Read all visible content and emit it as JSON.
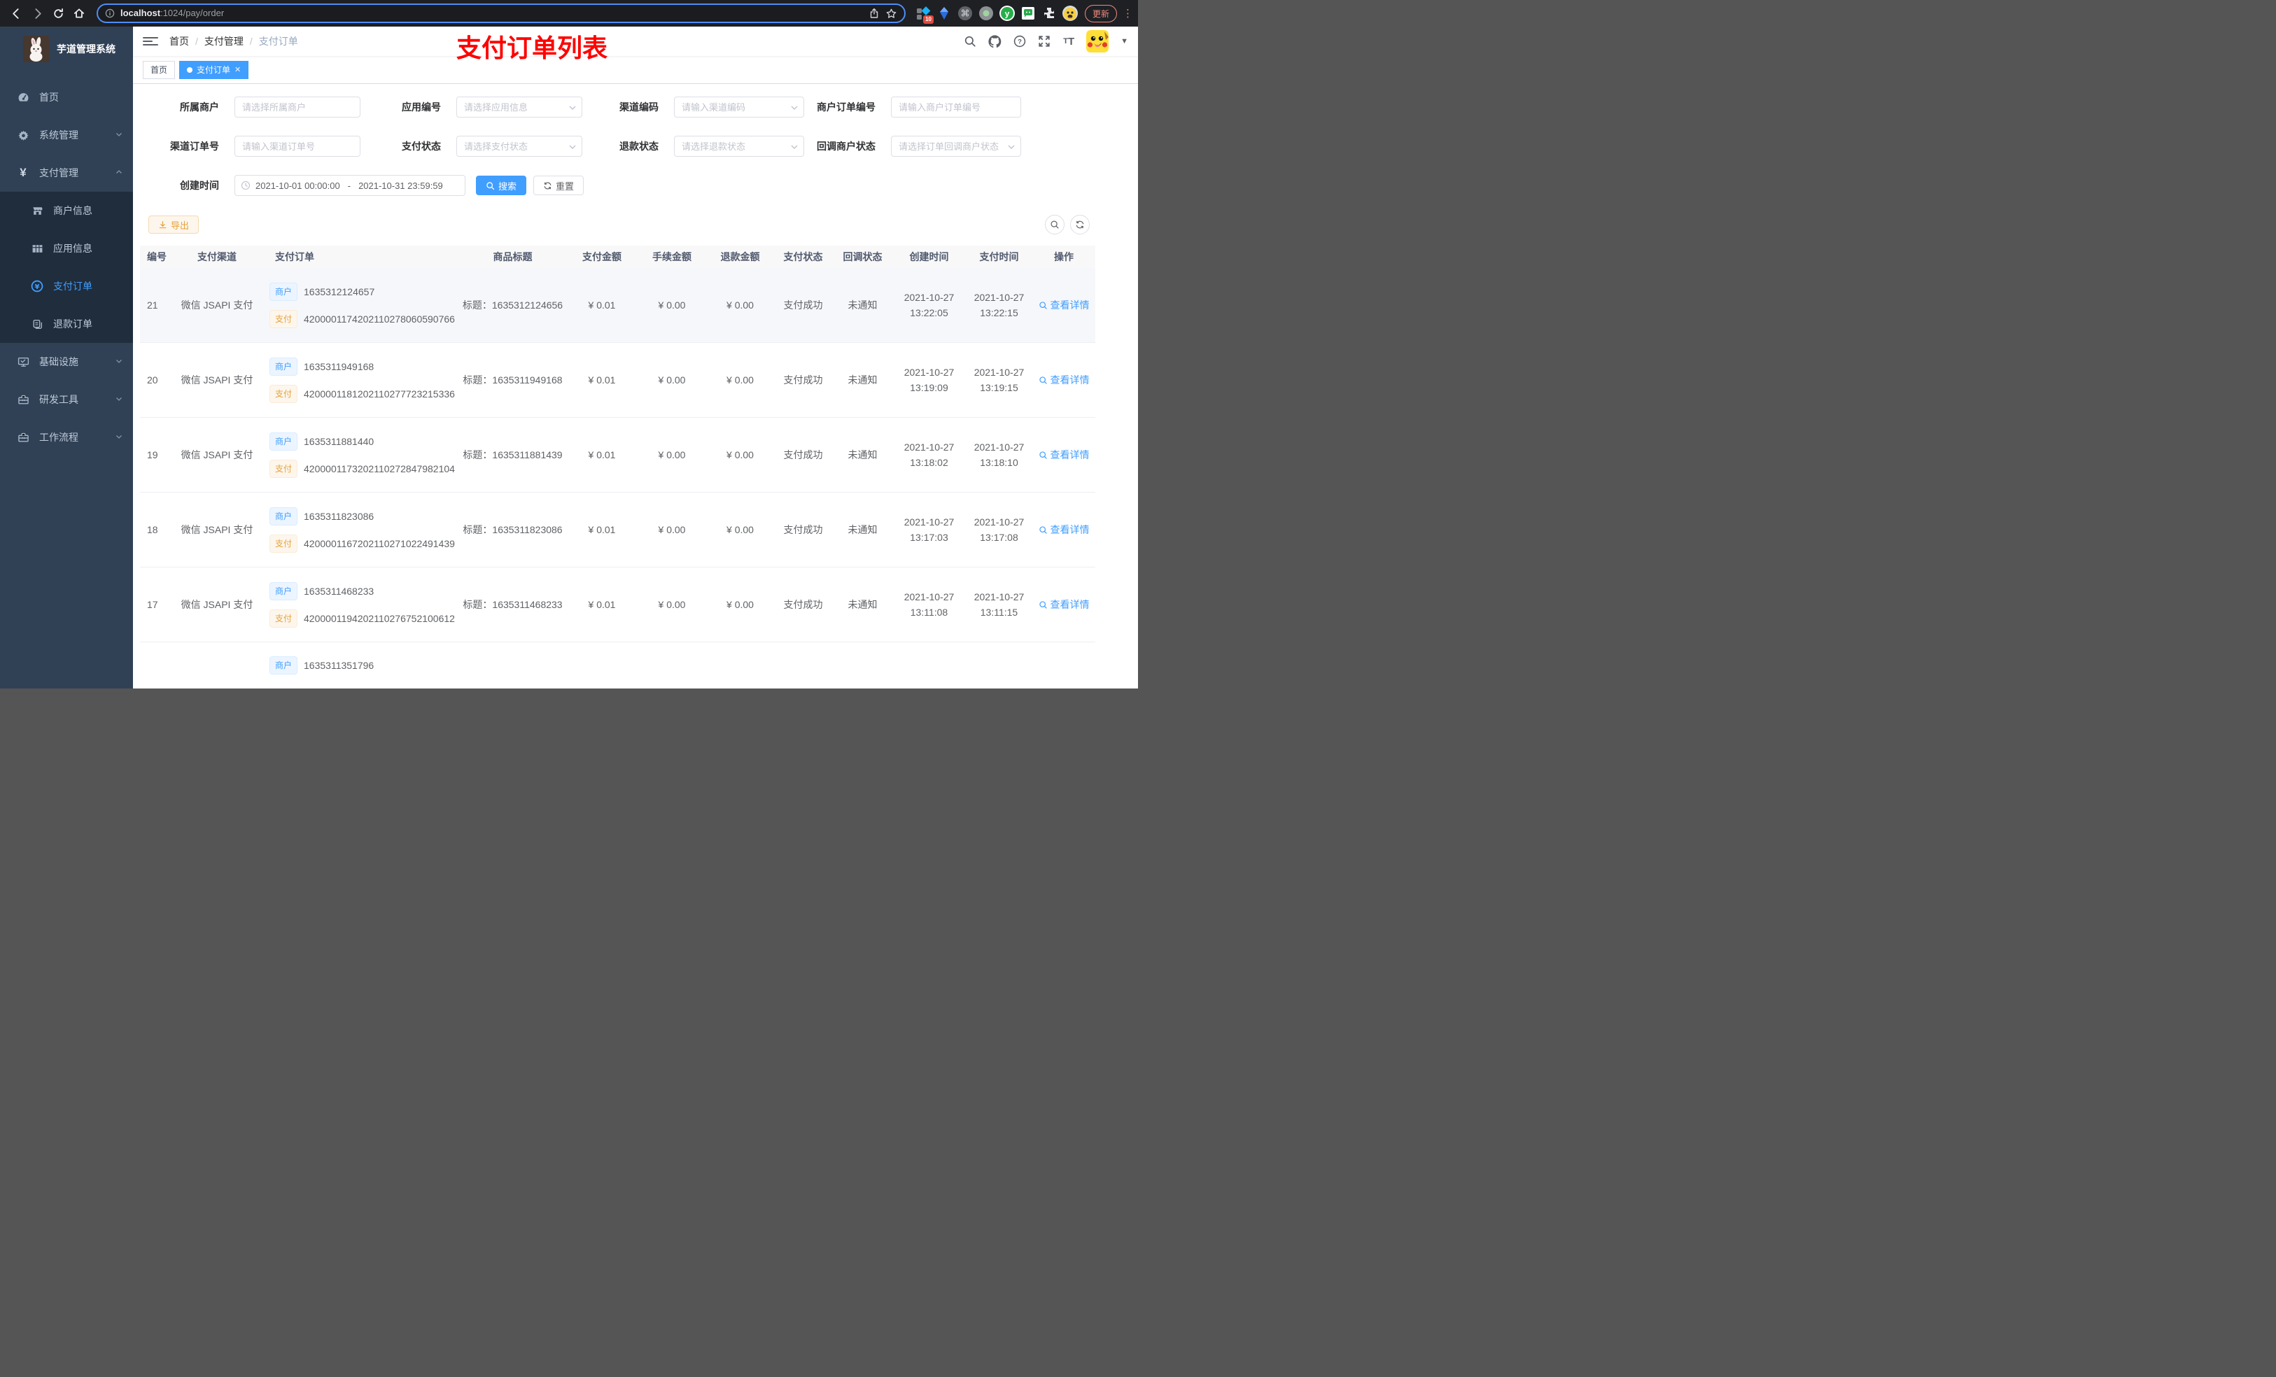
{
  "browser": {
    "url_host": "localhost",
    "url_rest": ":1024/pay/order",
    "update_label": "更新",
    "extension_badge": "10"
  },
  "sidebar": {
    "title": "芋道管理系统",
    "items": [
      {
        "label": "首页"
      },
      {
        "label": "系统管理"
      },
      {
        "label": "支付管理"
      },
      {
        "label": "商户信息"
      },
      {
        "label": "应用信息"
      },
      {
        "label": "支付订单"
      },
      {
        "label": "退款订单"
      },
      {
        "label": "基础设施"
      },
      {
        "label": "研发工具"
      },
      {
        "label": "工作流程"
      }
    ]
  },
  "header": {
    "breadcrumb": [
      "首页",
      "支付管理",
      "支付订单"
    ],
    "annotation": "支付订单列表"
  },
  "tabs": {
    "home": "首页",
    "current": "支付订单"
  },
  "filters": {
    "merchant": {
      "label": "所属商户",
      "placeholder": "请选择所属商户"
    },
    "app": {
      "label": "应用编号",
      "placeholder": "请选择应用信息"
    },
    "channel_code": {
      "label": "渠道编码",
      "placeholder": "请输入渠道编码"
    },
    "merchant_order_no": {
      "label": "商户订单编号",
      "placeholder": "请输入商户订单编号"
    },
    "channel_order_no": {
      "label": "渠道订单号",
      "placeholder": "请输入渠道订单号"
    },
    "pay_status": {
      "label": "支付状态",
      "placeholder": "请选择支付状态"
    },
    "refund_status": {
      "label": "退款状态",
      "placeholder": "请选择退款状态"
    },
    "callback_status": {
      "label": "回调商户状态",
      "placeholder": "请选择订单回调商户状态"
    },
    "create_time": {
      "label": "创建时间",
      "start": "2021-10-01 00:00:00",
      "separator": "-",
      "end": "2021-10-31 23:59:59"
    },
    "search_label": "搜索",
    "reset_label": "重置"
  },
  "toolbar": {
    "export_label": "导出"
  },
  "table": {
    "columns": [
      "编号",
      "支付渠道",
      "支付订单",
      "商品标题",
      "支付金额",
      "手续金额",
      "退款金额",
      "支付状态",
      "回调状态",
      "创建时间",
      "支付时间",
      "操作"
    ],
    "tag_merchant": "商户",
    "tag_pay": "支付",
    "action_label": "查看详情",
    "rows": [
      {
        "id": "21",
        "channel": "微信 JSAPI 支付",
        "merchant_no": "1635312124657",
        "channel_no": "4200001174202110278060590766",
        "title": "标题：1635312124656",
        "amount": "¥ 0.01",
        "fee": "¥ 0.00",
        "refund": "¥ 0.00",
        "status": "支付成功",
        "notify": "未通知",
        "create_date": "2021-10-27",
        "create_clock": "13:22:05",
        "pay_date": "2021-10-27",
        "pay_clock": "13:22:15"
      },
      {
        "id": "20",
        "channel": "微信 JSAPI 支付",
        "merchant_no": "1635311949168",
        "channel_no": "4200001181202110277723215336",
        "title": "标题：1635311949168",
        "amount": "¥ 0.01",
        "fee": "¥ 0.00",
        "refund": "¥ 0.00",
        "status": "支付成功",
        "notify": "未通知",
        "create_date": "2021-10-27",
        "create_clock": "13:19:09",
        "pay_date": "2021-10-27",
        "pay_clock": "13:19:15"
      },
      {
        "id": "19",
        "channel": "微信 JSAPI 支付",
        "merchant_no": "1635311881440",
        "channel_no": "4200001173202110272847982104",
        "title": "标题：1635311881439",
        "amount": "¥ 0.01",
        "fee": "¥ 0.00",
        "refund": "¥ 0.00",
        "status": "支付成功",
        "notify": "未通知",
        "create_date": "2021-10-27",
        "create_clock": "13:18:02",
        "pay_date": "2021-10-27",
        "pay_clock": "13:18:10"
      },
      {
        "id": "18",
        "channel": "微信 JSAPI 支付",
        "merchant_no": "1635311823086",
        "channel_no": "4200001167202110271022491439",
        "title": "标题：1635311823086",
        "amount": "¥ 0.01",
        "fee": "¥ 0.00",
        "refund": "¥ 0.00",
        "status": "支付成功",
        "notify": "未通知",
        "create_date": "2021-10-27",
        "create_clock": "13:17:03",
        "pay_date": "2021-10-27",
        "pay_clock": "13:17:08"
      },
      {
        "id": "17",
        "channel": "微信 JSAPI 支付",
        "merchant_no": "1635311468233",
        "channel_no": "4200001194202110276752100612",
        "title": "标题：1635311468233",
        "amount": "¥ 0.01",
        "fee": "¥ 0.00",
        "refund": "¥ 0.00",
        "status": "支付成功",
        "notify": "未通知",
        "create_date": "2021-10-27",
        "create_clock": "13:11:08",
        "pay_date": "2021-10-27",
        "pay_clock": "13:11:15"
      },
      {
        "partial": true,
        "id": "",
        "channel": "",
        "merchant_no": "1635311351796",
        "channel_no": "",
        "title": "",
        "amount": "",
        "fee": "",
        "refund": "",
        "status": "",
        "notify": "",
        "create_date": "",
        "create_clock": "",
        "pay_date": "",
        "pay_clock": ""
      }
    ]
  }
}
